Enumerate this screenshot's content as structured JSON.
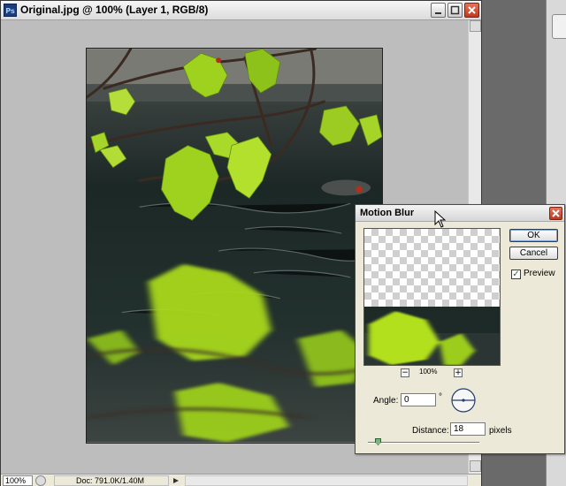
{
  "window": {
    "title": "Original.jpg @ 100% (Layer 1, RGB/8)",
    "app_icon": "Ps"
  },
  "statusbar": {
    "zoom": "100%",
    "doc_size": "Doc: 791.0K/1.40M"
  },
  "dialog": {
    "title": "Motion Blur",
    "ok_label": "OK",
    "cancel_label": "Cancel",
    "preview_label": "Preview",
    "preview_checked": true,
    "preview_zoom": "100%",
    "angle_label": "Angle:",
    "angle_value": "0",
    "degree_symbol": "°",
    "distance_label": "Distance:",
    "distance_value": "18",
    "distance_unit": "pixels"
  },
  "icons": [
    "photoshop-app-icon",
    "minimize-icon",
    "maximize-icon",
    "close-icon",
    "zoom-out-icon",
    "zoom-in-icon",
    "angle-dial-icon",
    "mouse-pointer-icon"
  ],
  "colors": {
    "canvas_bg": "#bdbdbd",
    "dialog_bg": "#ece9d8",
    "close_red": "#c0381f"
  }
}
